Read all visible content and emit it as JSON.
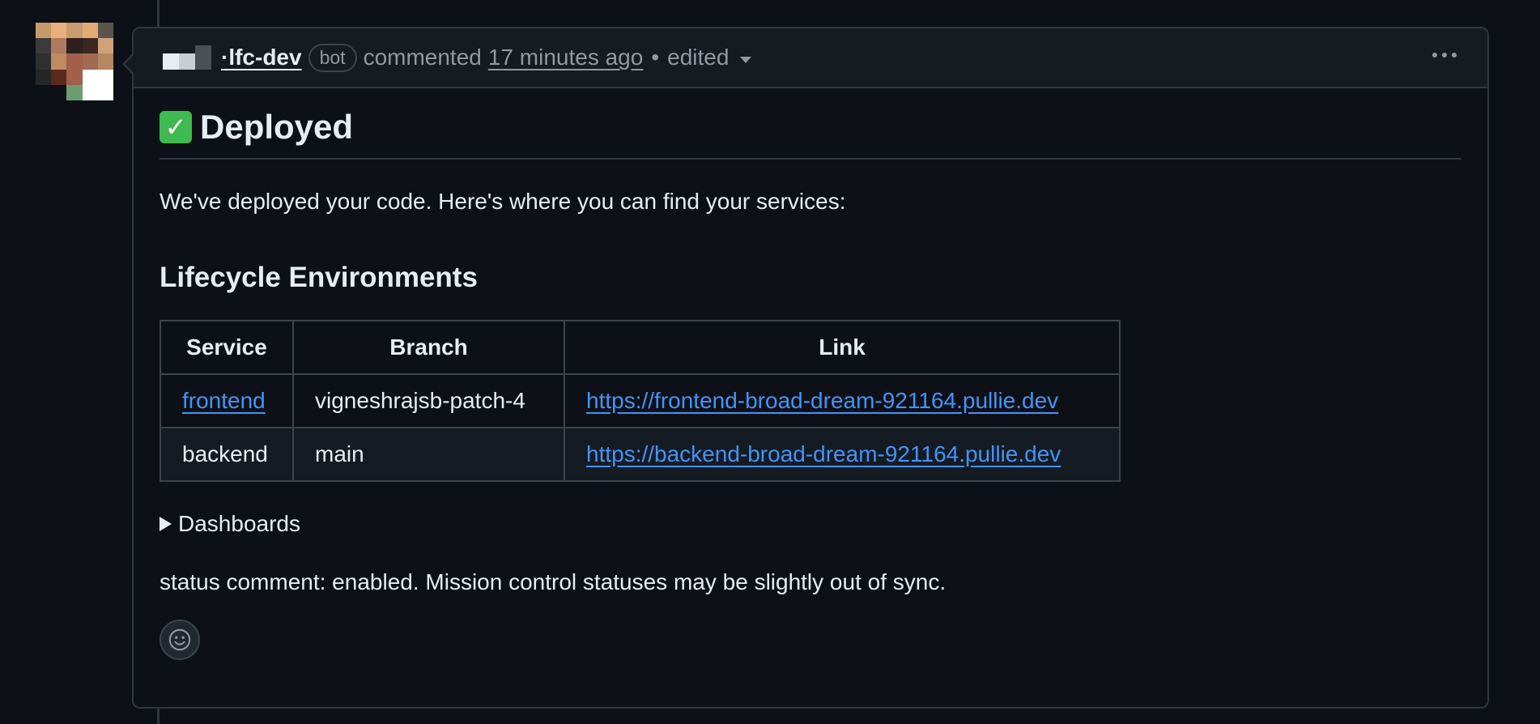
{
  "comment": {
    "author": "·lfc-dev",
    "badge": "bot",
    "action": "commented",
    "time": "17 minutes ago",
    "separator": "•",
    "edited": "edited"
  },
  "body": {
    "heading_emoji": "✓",
    "heading": "Deployed",
    "intro": "We've deployed your code. Here's where you can find your services:",
    "section_title": "Lifecycle Environments",
    "table": {
      "headers": [
        "Service",
        "Branch",
        "Link"
      ],
      "rows": [
        {
          "service": "frontend",
          "branch": "vigneshrajsb-patch-4",
          "link": "https://frontend-broad-dream-921164.pullie.dev"
        },
        {
          "service": "backend",
          "branch": "main",
          "link": "https://backend-broad-dream-921164.pullie.dev"
        }
      ]
    },
    "details_summary": "Dashboards",
    "status": "status comment: enabled. Mission control statuses may be slightly out of sync."
  },
  "icons": {
    "more": "kebab-horizontal-icon",
    "reaction": "smiley-icon",
    "dropdown": "triangle-down-icon",
    "details": "triangle-right-icon",
    "heading": "white-check-mark-icon"
  },
  "colors": {
    "background": "#0d1117",
    "header_bg": "#161b22",
    "border": "#30363d",
    "text": "#e6edf3",
    "muted": "#9198a1",
    "link": "#4493f8",
    "check": "#3fb950"
  }
}
